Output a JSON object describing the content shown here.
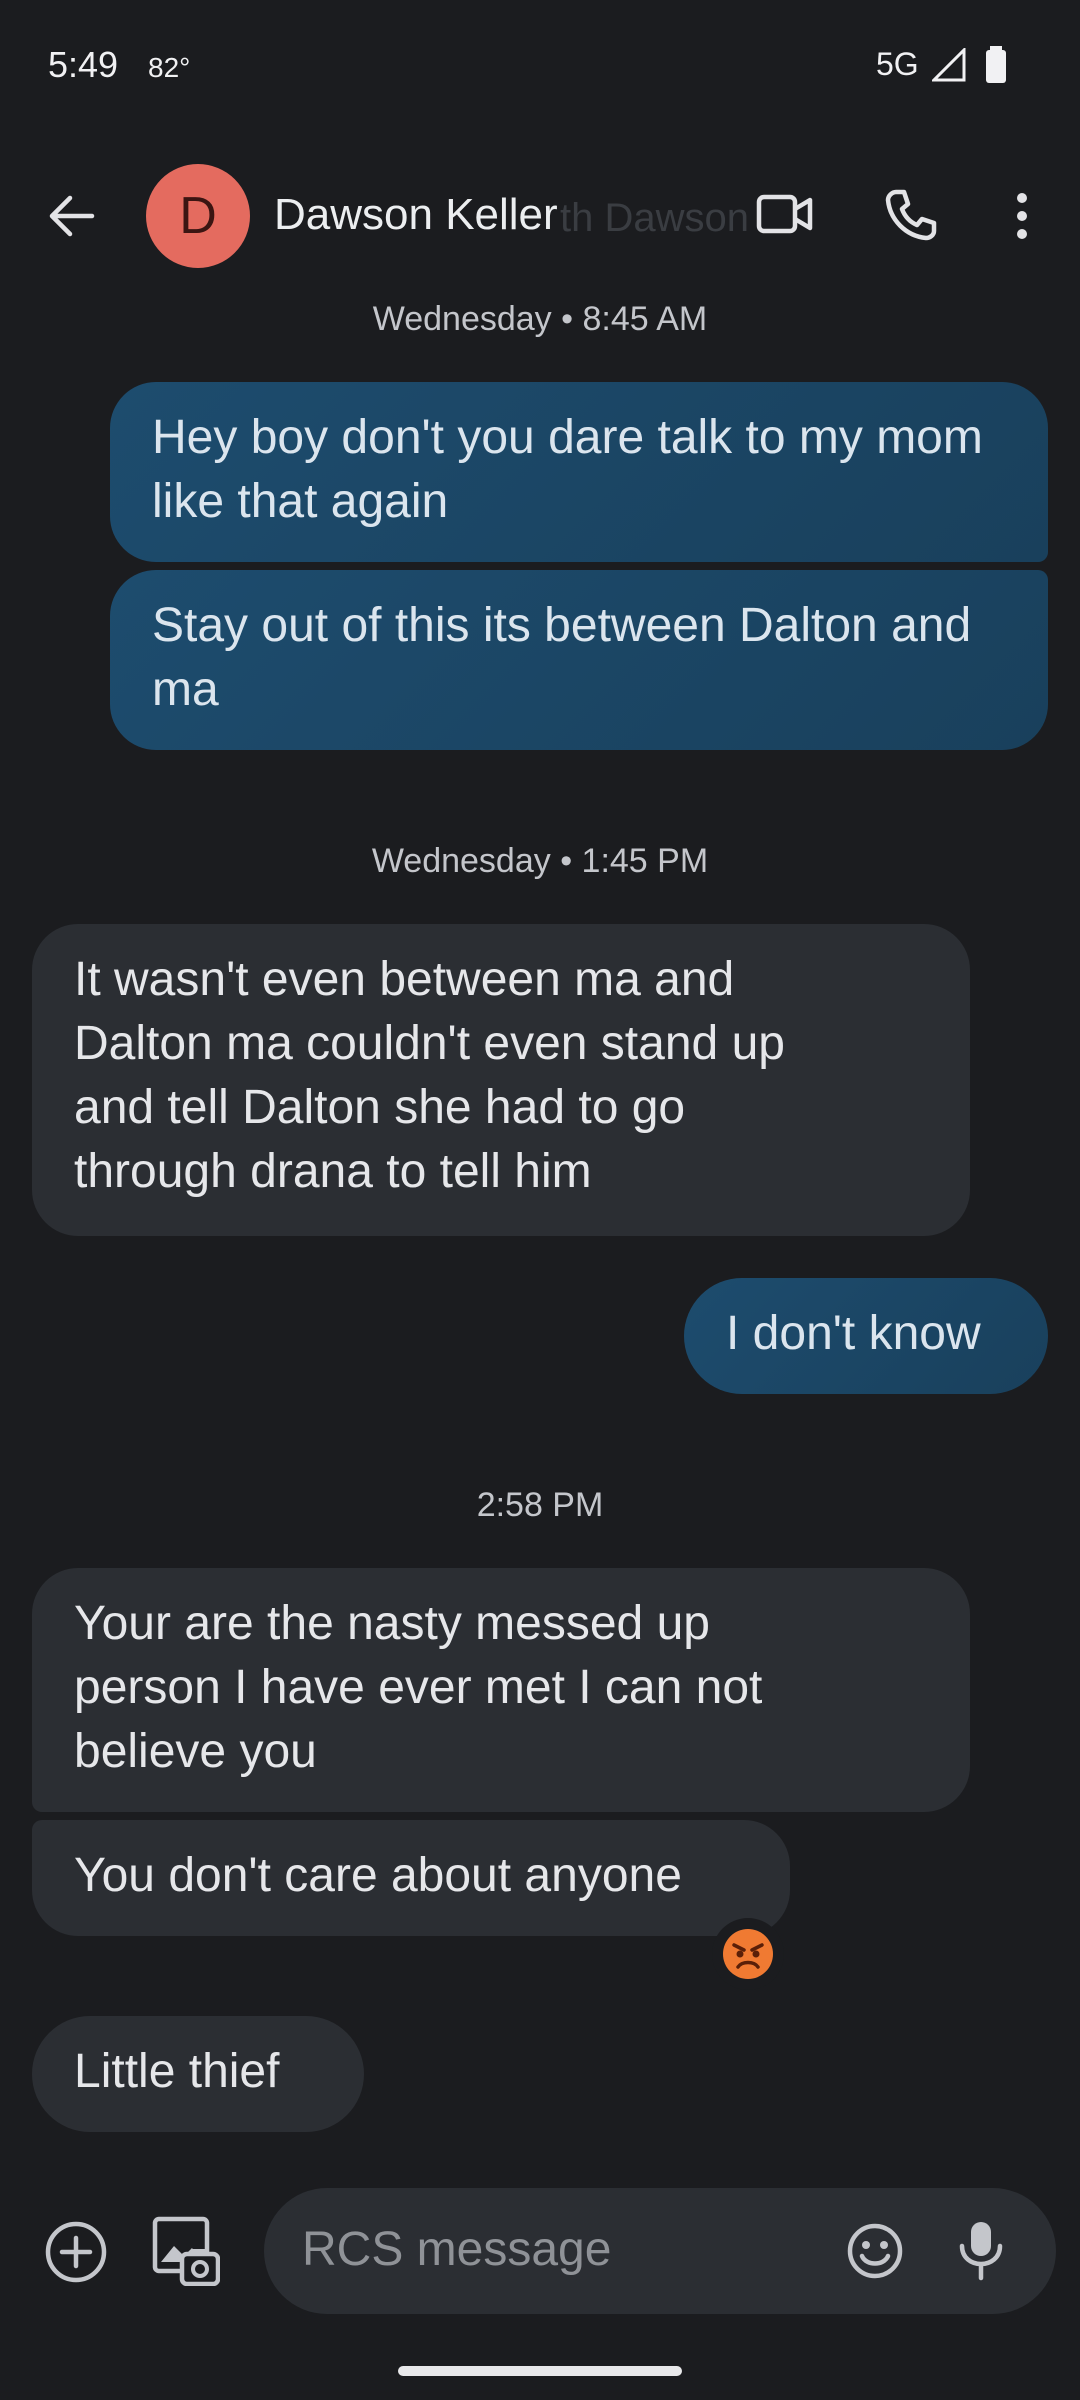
{
  "status_bar": {
    "time": "5:49",
    "temperature": "82°",
    "network": "5G"
  },
  "header": {
    "avatar_letter": "D",
    "contact_name": "Dawson Keller",
    "ghost_text": "th Dawson",
    "icons": [
      "back-arrow-icon",
      "video-camera-icon",
      "phone-icon",
      "more-vert-icon"
    ]
  },
  "messages": [
    {
      "type": "timestamp",
      "text": "Wednesday • 8:45 AM"
    },
    {
      "type": "outgoing",
      "text": "Hey boy don't you dare talk to my mom like that again"
    },
    {
      "type": "outgoing",
      "text": "Stay out of this its between Dalton and ma"
    },
    {
      "type": "timestamp",
      "text": "Wednesday • 1:45 PM"
    },
    {
      "type": "incoming",
      "text": "It wasn't even between ma and Dalton ma couldn't even stand up and tell Dalton she had to go through drana to tell him"
    },
    {
      "type": "outgoing",
      "text": "I don't know"
    },
    {
      "type": "timestamp",
      "text": "2:58 PM"
    },
    {
      "type": "incoming",
      "text": "Your are the nasty messed up person I have ever met I can not believe you"
    },
    {
      "type": "incoming",
      "text": "You don't care about anyone",
      "reaction": "😡"
    },
    {
      "type": "incoming",
      "text": "Little thief"
    }
  ],
  "composer": {
    "placeholder": "RCS message",
    "icons": [
      "add-circle-icon",
      "gallery-icon",
      "emoji-icon",
      "mic-icon"
    ]
  },
  "colors": {
    "background": "#1b1c1f",
    "outgoing": "#1d4c6e",
    "incoming": "#2b2e33",
    "avatar": "#e46b5f"
  }
}
